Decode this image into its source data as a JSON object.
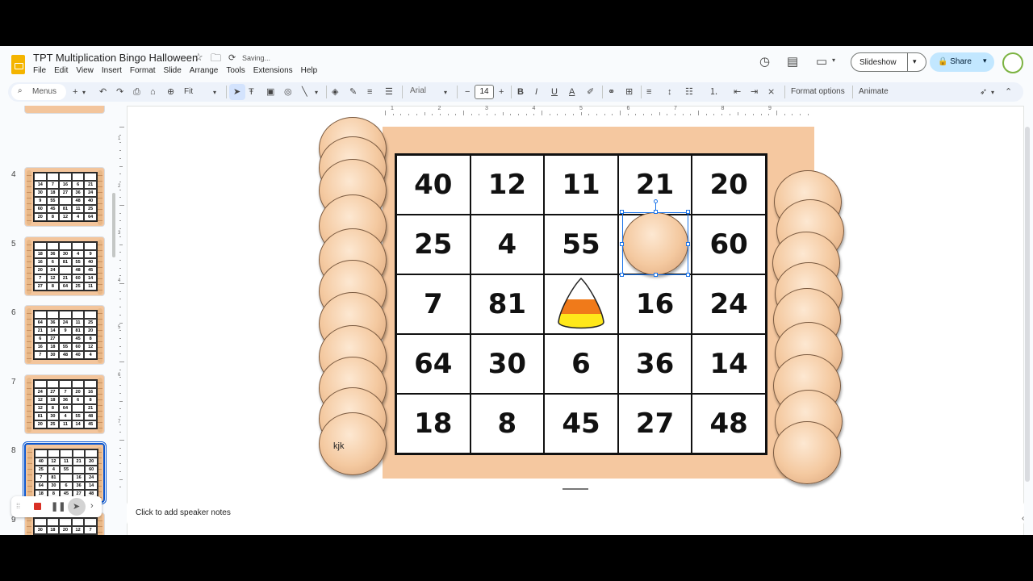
{
  "app": {
    "title": "TPT Multiplication Bingo Halloween",
    "saving_status": "Saving...",
    "menu": [
      "File",
      "Edit",
      "View",
      "Insert",
      "Format",
      "Slide",
      "Arrange",
      "Tools",
      "Extensions",
      "Help"
    ],
    "slideshow_label": "Slideshow",
    "share_label": "Share"
  },
  "toolbar": {
    "menus_label": "Menus",
    "zoom": "Fit",
    "font_family": "Arial",
    "font_size": "14",
    "format_options": "Format options",
    "animate": "Animate"
  },
  "ruler": {
    "h_labels": [
      "1",
      "2",
      "3",
      "4",
      "5",
      "6",
      "7",
      "8",
      "9"
    ],
    "v_labels": [
      "1",
      "2",
      "3",
      "4",
      "5",
      "6",
      "7"
    ]
  },
  "filmstrip": {
    "slides": [
      {
        "num": "4",
        "cells": [
          "14",
          "7",
          "16",
          "6",
          "21",
          "30",
          "18",
          "27",
          "36",
          "24",
          "9",
          "55",
          "",
          "48",
          "40",
          "60",
          "45",
          "81",
          "11",
          "25",
          "20",
          "8",
          "12",
          "4",
          "64"
        ]
      },
      {
        "num": "5",
        "cells": [
          "18",
          "36",
          "30",
          "4",
          "9",
          "16",
          "6",
          "81",
          "55",
          "40",
          "20",
          "24",
          "",
          "48",
          "45",
          "7",
          "12",
          "21",
          "60",
          "14",
          "27",
          "8",
          "64",
          "25",
          "11"
        ]
      },
      {
        "num": "6",
        "cells": [
          "64",
          "36",
          "24",
          "11",
          "25",
          "21",
          "14",
          "9",
          "81",
          "20",
          "6",
          "27",
          "",
          "45",
          "8",
          "16",
          "18",
          "55",
          "60",
          "12",
          "7",
          "30",
          "48",
          "40",
          "4"
        ]
      },
      {
        "num": "7",
        "cells": [
          "24",
          "27",
          "7",
          "20",
          "16",
          "12",
          "18",
          "36",
          "6",
          "8",
          "12",
          "8",
          "64",
          "",
          "21",
          "81",
          "30",
          "4",
          "55",
          "48",
          "20",
          "25",
          "11",
          "14",
          "45",
          "40"
        ]
      },
      {
        "num": "8",
        "selected": true,
        "cells": [
          "40",
          "12",
          "11",
          "21",
          "20",
          "25",
          "4",
          "55",
          "",
          "60",
          "7",
          "81",
          "",
          "16",
          "24",
          "64",
          "30",
          "6",
          "36",
          "14",
          "18",
          "8",
          "45",
          "27",
          "48"
        ]
      },
      {
        "num": "9",
        "cells": [
          "30",
          "18",
          "20",
          "12",
          "7",
          "9",
          "81",
          "60",
          "21",
          "6",
          "",
          "",
          "",
          "",
          ""
        ]
      }
    ]
  },
  "slide": {
    "grid": [
      [
        "40",
        "12",
        "11",
        "21",
        "20"
      ],
      [
        "25",
        "4",
        "55",
        "",
        "60"
      ],
      [
        "7",
        "81",
        "",
        "16",
        "24"
      ],
      [
        "64",
        "30",
        "6",
        "36",
        "14"
      ],
      [
        "18",
        "8",
        "45",
        "27",
        "48"
      ]
    ],
    "chip_text": "kjk"
  },
  "notes": {
    "placeholder": "Click to add speaker notes"
  }
}
